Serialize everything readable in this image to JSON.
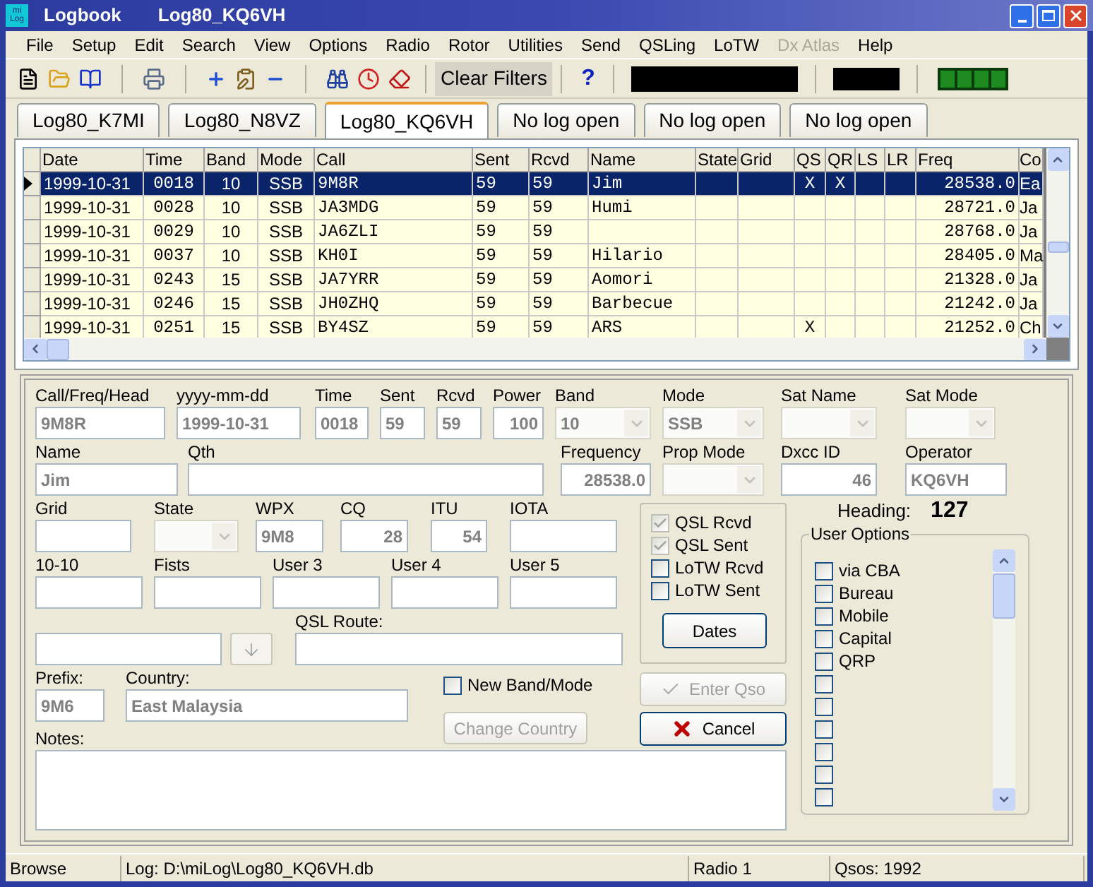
{
  "window": {
    "icon_text": [
      "mi",
      "Log"
    ],
    "title": "Logbook",
    "subtitle": "Log80_KQ6VH"
  },
  "menu": [
    {
      "label": "File",
      "disabled": false
    },
    {
      "label": "Setup",
      "disabled": false
    },
    {
      "label": "Edit",
      "disabled": false
    },
    {
      "label": "Search",
      "disabled": false
    },
    {
      "label": "View",
      "disabled": false
    },
    {
      "label": "Options",
      "disabled": false
    },
    {
      "label": "Radio",
      "disabled": false
    },
    {
      "label": "Rotor",
      "disabled": false
    },
    {
      "label": "Utilities",
      "disabled": false
    },
    {
      "label": "Send",
      "disabled": false
    },
    {
      "label": "QSLing",
      "disabled": false
    },
    {
      "label": "LoTW",
      "disabled": false
    },
    {
      "label": "Dx Atlas",
      "disabled": true
    },
    {
      "label": "Help",
      "disabled": false
    }
  ],
  "toolbar": {
    "clear_filters": "Clear Filters",
    "help": "?"
  },
  "tabs": [
    {
      "label": "Log80_K7MI",
      "selected": false
    },
    {
      "label": "Log80_N8VZ",
      "selected": false
    },
    {
      "label": "Log80_KQ6VH",
      "selected": true
    },
    {
      "label": "No log open",
      "selected": false
    },
    {
      "label": "No log open",
      "selected": false
    },
    {
      "label": "No log open",
      "selected": false
    }
  ],
  "table": {
    "columns": [
      "Date",
      "Time",
      "Band",
      "Mode",
      "Call",
      "Sent",
      "Rcvd",
      "Name",
      "State",
      "Grid",
      "QS",
      "QR",
      "LS",
      "LR",
      "Freq",
      "Co"
    ],
    "rows": [
      {
        "selected": true,
        "cells": [
          "1999-10-31",
          "0018",
          "10",
          "SSB",
          "9M8R",
          "59",
          "59",
          "Jim",
          null,
          null,
          "X",
          "X",
          null,
          null,
          "28538.0",
          "Ea"
        ]
      },
      {
        "selected": false,
        "cells": [
          "1999-10-31",
          "0028",
          "10",
          "SSB",
          "JA3MDG",
          "59",
          "59",
          "Humi",
          null,
          null,
          null,
          null,
          null,
          null,
          "28721.0",
          "Ja"
        ]
      },
      {
        "selected": false,
        "cells": [
          "1999-10-31",
          "0029",
          "10",
          "SSB",
          "JA6ZLI",
          "59",
          "59",
          null,
          null,
          null,
          null,
          null,
          null,
          null,
          "28768.0",
          "Ja"
        ]
      },
      {
        "selected": false,
        "cells": [
          "1999-10-31",
          "0037",
          "10",
          "SSB",
          "KH0I",
          "59",
          "59",
          "Hilario",
          null,
          null,
          null,
          null,
          null,
          null,
          "28405.0",
          "Ma"
        ]
      },
      {
        "selected": false,
        "cells": [
          "1999-10-31",
          "0243",
          "15",
          "SSB",
          "JA7YRR",
          "59",
          "59",
          "Aomori",
          null,
          null,
          null,
          null,
          null,
          null,
          "21328.0",
          "Ja"
        ]
      },
      {
        "selected": false,
        "cells": [
          "1999-10-31",
          "0246",
          "15",
          "SSB",
          "JH0ZHQ",
          "59",
          "59",
          "Barbecue",
          null,
          null,
          null,
          null,
          null,
          null,
          "21242.0",
          "Ja"
        ]
      },
      {
        "selected": false,
        "cells": [
          "1999-10-31",
          "0251",
          "15",
          "SSB",
          "BY4SZ",
          "59",
          "59",
          "ARS",
          null,
          null,
          "X",
          null,
          null,
          null,
          "21252.0",
          "Ch"
        ]
      }
    ]
  },
  "form": {
    "lines": [
      {
        "fields": [
          {
            "label": "Call/Freq/Head",
            "value": "9M8R",
            "kind": "text"
          },
          {
            "label": "yyyy-mm-dd",
            "value": "1999-10-31",
            "kind": "text"
          },
          {
            "label": "Time",
            "value": "0018",
            "kind": "text"
          },
          {
            "label": "Sent",
            "value": "59",
            "kind": "text"
          },
          {
            "label": "Rcvd",
            "value": "59",
            "kind": "text"
          },
          {
            "label": "Power",
            "value": "100",
            "kind": "text"
          },
          {
            "label": "Band",
            "value": "10",
            "kind": "select"
          },
          {
            "label": "Mode",
            "value": "SSB",
            "kind": "select"
          },
          {
            "label": "Sat Name",
            "kind": "select"
          },
          {
            "label": "Sat Mode",
            "kind": "select"
          }
        ]
      },
      {
        "fields": [
          {
            "label": "Name",
            "value": "Jim",
            "kind": "text"
          },
          {
            "label": "Qth",
            "kind": "text"
          },
          {
            "label": "Frequency",
            "value": "28538.0",
            "kind": "text"
          },
          {
            "label": "Prop Mode",
            "kind": "select"
          },
          {
            "label": "Dxcc ID",
            "value": "46",
            "kind": "text"
          },
          {
            "label": "Operator",
            "value": "KQ6VH",
            "kind": "text"
          }
        ]
      },
      {
        "fields": [
          {
            "label": "Grid",
            "kind": "text"
          },
          {
            "label": "State",
            "kind": "select"
          },
          {
            "label": "WPX",
            "value": "9M8",
            "kind": "text"
          },
          {
            "label": "CQ",
            "value": "28",
            "kind": "text"
          },
          {
            "label": "ITU",
            "value": "54",
            "kind": "text"
          },
          {
            "label": "IOTA",
            "kind": "text"
          }
        ]
      },
      {
        "fields": [
          {
            "label": "10-10",
            "kind": "text"
          },
          {
            "label": "Fists",
            "kind": "text"
          },
          {
            "label": "User 3",
            "kind": "text"
          },
          {
            "label": "User 4",
            "kind": "text"
          },
          {
            "label": "User 5",
            "kind": "text"
          }
        ]
      },
      {
        "fields": [
          {
            "kind": "text"
          },
          {
            "kind": "button"
          },
          {
            "label": "QSL Route:",
            "kind": "text"
          }
        ]
      },
      {
        "fields": [
          {
            "label": "Prefix:",
            "value": "9M6",
            "kind": "text"
          },
          {
            "label": "Country:",
            "value": "East Malaysia",
            "kind": "text"
          }
        ]
      }
    ],
    "new_band_mode": {
      "label": "New Band/Mode",
      "checked": false
    },
    "change_country": {
      "label": "Change Country",
      "disabled": true
    },
    "notes": {
      "label": "Notes:"
    }
  },
  "qsl_status": [
    {
      "label": "QSL Rcvd",
      "checked": true
    },
    {
      "label": "QSL Sent",
      "checked": true
    },
    {
      "label": "LoTW Rcvd",
      "checked": false
    },
    {
      "label": "LoTW Sent",
      "checked": false
    }
  ],
  "dates_button": "Dates",
  "enter_qso": {
    "label": "Enter Qso",
    "disabled": true
  },
  "cancel": {
    "label": "Cancel"
  },
  "heading": {
    "label": "Heading:",
    "value": "127"
  },
  "user_options": {
    "title": "User Options",
    "items": [
      {
        "label": "via CBA",
        "checked": false
      },
      {
        "label": "Bureau",
        "checked": false
      },
      {
        "label": "Mobile",
        "checked": false
      },
      {
        "label": "Capital",
        "checked": false
      },
      {
        "label": "QRP",
        "checked": false
      },
      {
        "checked": false
      },
      {
        "checked": false
      },
      {
        "checked": false
      },
      {
        "checked": false
      },
      {
        "checked": false
      },
      {
        "checked": false
      }
    ]
  },
  "status_bar": [
    "Browse",
    "Log: D:\\miLog\\Log80_KQ6VH.db",
    "Radio 1",
    "Qsos: 1992"
  ]
}
